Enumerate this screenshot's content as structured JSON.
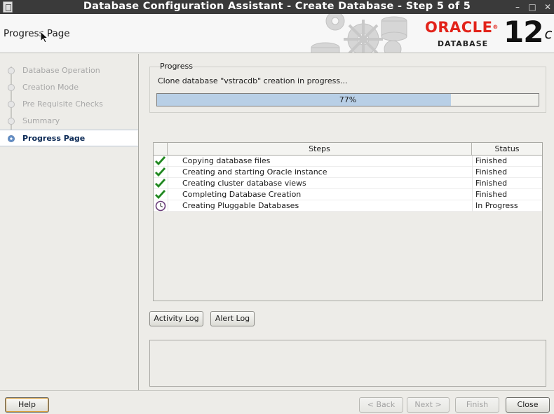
{
  "window": {
    "title": "Database Configuration Assistant - Create Database - Step 5 of 5",
    "controls": [
      "–",
      "□",
      "✕"
    ]
  },
  "header": {
    "page_title": "Progress Page",
    "brand": {
      "oracle": "ORACLE",
      "registered": "®",
      "database": "DATABASE",
      "version": "12",
      "version_suffix": "c"
    }
  },
  "sidebar": {
    "items": [
      {
        "label": "Database Operation",
        "state": "done"
      },
      {
        "label": "Creation Mode",
        "state": "done"
      },
      {
        "label": "Pre Requisite Checks",
        "state": "done"
      },
      {
        "label": "Summary",
        "state": "done"
      },
      {
        "label": "Progress Page",
        "state": "current"
      }
    ]
  },
  "progress": {
    "group_title": "Progress",
    "status_text": "Clone database \"vstracdb\" creation in progress...",
    "percent_label": "77%",
    "percent_value": 77
  },
  "steps_table": {
    "columns": [
      "Steps",
      "Status"
    ],
    "rows": [
      {
        "step": "Copying database files",
        "status": "Finished",
        "icon": "check-icon"
      },
      {
        "step": "Creating and starting Oracle instance",
        "status": "Finished",
        "icon": "check-icon"
      },
      {
        "step": "Creating cluster database views",
        "status": "Finished",
        "icon": "check-icon"
      },
      {
        "step": "Completing Database Creation",
        "status": "Finished",
        "icon": "check-icon"
      },
      {
        "step": "Creating Pluggable Databases",
        "status": "In Progress",
        "icon": "clock-icon"
      }
    ]
  },
  "log_buttons": {
    "activity": "Activity Log",
    "alert": "Alert Log"
  },
  "footer": {
    "help": "Help",
    "back": "< Back",
    "next": "Next >",
    "finish": "Finish",
    "close": "Close"
  },
  "colors": {
    "titlebar": "#3a3a3a",
    "oracle_red": "#e2231a",
    "progress_fill": "#b8cfe6",
    "check_green": "#2ea12e",
    "active_nav_text": "#0c2a56"
  }
}
